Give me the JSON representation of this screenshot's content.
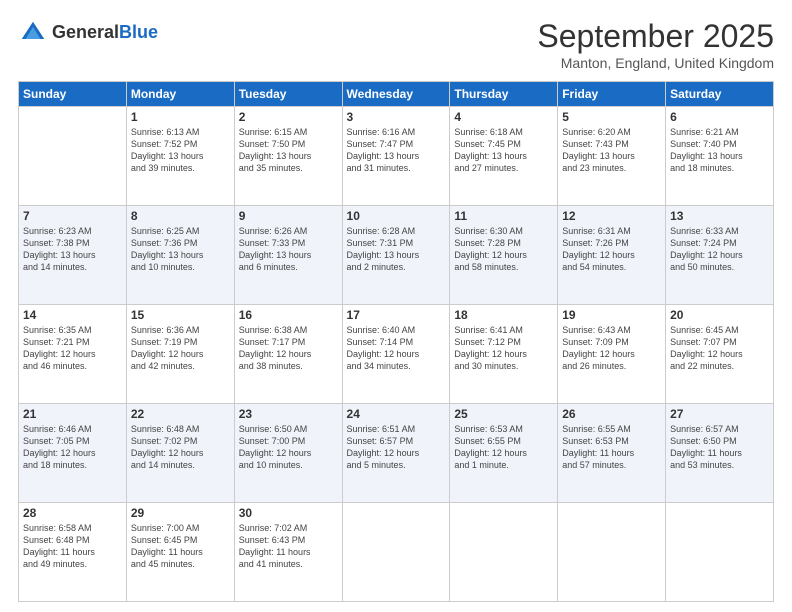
{
  "logo": {
    "line1": "General",
    "line2": "Blue"
  },
  "title": "September 2025",
  "location": "Manton, England, United Kingdom",
  "days_of_week": [
    "Sunday",
    "Monday",
    "Tuesday",
    "Wednesday",
    "Thursday",
    "Friday",
    "Saturday"
  ],
  "weeks": [
    [
      {
        "day": "",
        "info": ""
      },
      {
        "day": "1",
        "info": "Sunrise: 6:13 AM\nSunset: 7:52 PM\nDaylight: 13 hours\nand 39 minutes."
      },
      {
        "day": "2",
        "info": "Sunrise: 6:15 AM\nSunset: 7:50 PM\nDaylight: 13 hours\nand 35 minutes."
      },
      {
        "day": "3",
        "info": "Sunrise: 6:16 AM\nSunset: 7:47 PM\nDaylight: 13 hours\nand 31 minutes."
      },
      {
        "day": "4",
        "info": "Sunrise: 6:18 AM\nSunset: 7:45 PM\nDaylight: 13 hours\nand 27 minutes."
      },
      {
        "day": "5",
        "info": "Sunrise: 6:20 AM\nSunset: 7:43 PM\nDaylight: 13 hours\nand 23 minutes."
      },
      {
        "day": "6",
        "info": "Sunrise: 6:21 AM\nSunset: 7:40 PM\nDaylight: 13 hours\nand 18 minutes."
      }
    ],
    [
      {
        "day": "7",
        "info": "Sunrise: 6:23 AM\nSunset: 7:38 PM\nDaylight: 13 hours\nand 14 minutes."
      },
      {
        "day": "8",
        "info": "Sunrise: 6:25 AM\nSunset: 7:36 PM\nDaylight: 13 hours\nand 10 minutes."
      },
      {
        "day": "9",
        "info": "Sunrise: 6:26 AM\nSunset: 7:33 PM\nDaylight: 13 hours\nand 6 minutes."
      },
      {
        "day": "10",
        "info": "Sunrise: 6:28 AM\nSunset: 7:31 PM\nDaylight: 13 hours\nand 2 minutes."
      },
      {
        "day": "11",
        "info": "Sunrise: 6:30 AM\nSunset: 7:28 PM\nDaylight: 12 hours\nand 58 minutes."
      },
      {
        "day": "12",
        "info": "Sunrise: 6:31 AM\nSunset: 7:26 PM\nDaylight: 12 hours\nand 54 minutes."
      },
      {
        "day": "13",
        "info": "Sunrise: 6:33 AM\nSunset: 7:24 PM\nDaylight: 12 hours\nand 50 minutes."
      }
    ],
    [
      {
        "day": "14",
        "info": "Sunrise: 6:35 AM\nSunset: 7:21 PM\nDaylight: 12 hours\nand 46 minutes."
      },
      {
        "day": "15",
        "info": "Sunrise: 6:36 AM\nSunset: 7:19 PM\nDaylight: 12 hours\nand 42 minutes."
      },
      {
        "day": "16",
        "info": "Sunrise: 6:38 AM\nSunset: 7:17 PM\nDaylight: 12 hours\nand 38 minutes."
      },
      {
        "day": "17",
        "info": "Sunrise: 6:40 AM\nSunset: 7:14 PM\nDaylight: 12 hours\nand 34 minutes."
      },
      {
        "day": "18",
        "info": "Sunrise: 6:41 AM\nSunset: 7:12 PM\nDaylight: 12 hours\nand 30 minutes."
      },
      {
        "day": "19",
        "info": "Sunrise: 6:43 AM\nSunset: 7:09 PM\nDaylight: 12 hours\nand 26 minutes."
      },
      {
        "day": "20",
        "info": "Sunrise: 6:45 AM\nSunset: 7:07 PM\nDaylight: 12 hours\nand 22 minutes."
      }
    ],
    [
      {
        "day": "21",
        "info": "Sunrise: 6:46 AM\nSunset: 7:05 PM\nDaylight: 12 hours\nand 18 minutes."
      },
      {
        "day": "22",
        "info": "Sunrise: 6:48 AM\nSunset: 7:02 PM\nDaylight: 12 hours\nand 14 minutes."
      },
      {
        "day": "23",
        "info": "Sunrise: 6:50 AM\nSunset: 7:00 PM\nDaylight: 12 hours\nand 10 minutes."
      },
      {
        "day": "24",
        "info": "Sunrise: 6:51 AM\nSunset: 6:57 PM\nDaylight: 12 hours\nand 5 minutes."
      },
      {
        "day": "25",
        "info": "Sunrise: 6:53 AM\nSunset: 6:55 PM\nDaylight: 12 hours\nand 1 minute."
      },
      {
        "day": "26",
        "info": "Sunrise: 6:55 AM\nSunset: 6:53 PM\nDaylight: 11 hours\nand 57 minutes."
      },
      {
        "day": "27",
        "info": "Sunrise: 6:57 AM\nSunset: 6:50 PM\nDaylight: 11 hours\nand 53 minutes."
      }
    ],
    [
      {
        "day": "28",
        "info": "Sunrise: 6:58 AM\nSunset: 6:48 PM\nDaylight: 11 hours\nand 49 minutes."
      },
      {
        "day": "29",
        "info": "Sunrise: 7:00 AM\nSunset: 6:45 PM\nDaylight: 11 hours\nand 45 minutes."
      },
      {
        "day": "30",
        "info": "Sunrise: 7:02 AM\nSunset: 6:43 PM\nDaylight: 11 hours\nand 41 minutes."
      },
      {
        "day": "",
        "info": ""
      },
      {
        "day": "",
        "info": ""
      },
      {
        "day": "",
        "info": ""
      },
      {
        "day": "",
        "info": ""
      }
    ]
  ]
}
